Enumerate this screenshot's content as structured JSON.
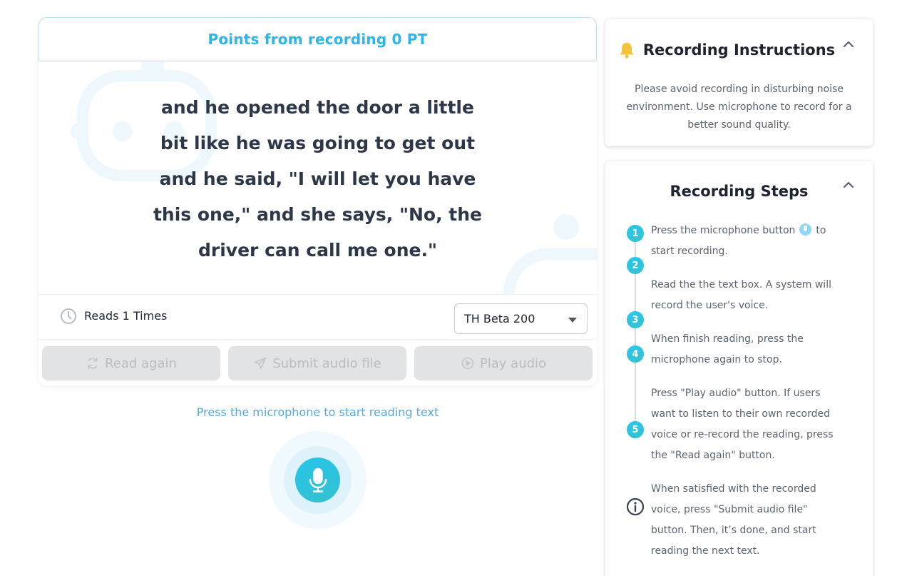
{
  "header": {
    "points_label": "Points from recording 0 PT"
  },
  "reading": {
    "text": "and he opened the door a little bit like he was going to get out and he said, \"I will let you have this one,\" and she says, \"No, the driver can call me one.\""
  },
  "status": {
    "reads_label": "Reads 1 Times",
    "model_selected": "TH Beta 200"
  },
  "buttons": {
    "read_again": "Read again",
    "submit_audio": "Submit audio file",
    "play_audio": "Play audio"
  },
  "mic_hint": "Press the microphone to start reading text",
  "instructions": {
    "title": "Recording Instructions",
    "body": "Please avoid recording in disturbing noise environment. Use microphone to record for a better sound quality."
  },
  "steps": {
    "title": "Recording Steps",
    "items": [
      {
        "num": "1",
        "text_before": "Press the microphone button",
        "text_after": "to start recording."
      },
      {
        "num": "2",
        "text": "Read the the text box. A system will record the user's voice."
      },
      {
        "num": "3",
        "text": "When finish reading, press the microphone again to stop."
      },
      {
        "num": "4",
        "text": "Press \"Play audio\" button. If users want to listen to their own recorded voice or re-record the reading, press the \"Read again\" button."
      },
      {
        "num": "5",
        "text": "When satisfied with the recorded voice, press \"Submit audio file\" button. Then, it’s done, and start reading the next text."
      }
    ]
  },
  "colors": {
    "accent": "#2cb5e8",
    "mic_gradient_start": "#27c4ea",
    "mic_gradient_end": "#33c1cf",
    "disabled_button_bg": "#e2e3e5",
    "disabled_button_text": "#b9bcc1",
    "hint_text": "#52a9df",
    "bell": "#f5c33b"
  },
  "icons": {
    "clock": "clock-icon",
    "read_again": "refresh-icon",
    "submit": "send-icon",
    "play": "play-circle-icon",
    "mic": "microphone-icon",
    "bell": "bell-icon",
    "collapse": "chevron-up-icon",
    "info": "info-icon"
  }
}
